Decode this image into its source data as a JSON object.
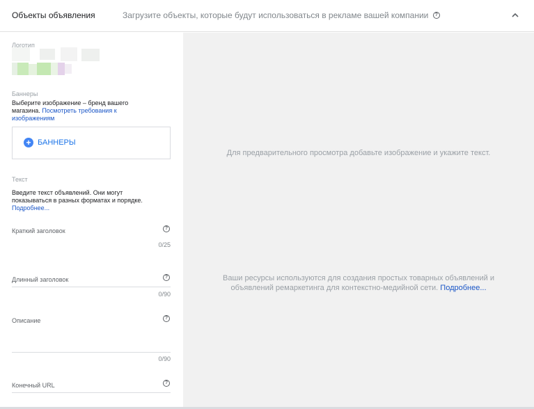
{
  "header": {
    "title": "Объекты объявления",
    "description": "Загрузите объекты, которые будут использоваться в рекламе вашей компании"
  },
  "logo": {
    "label": "Логотип"
  },
  "banners": {
    "label": "Баннеры",
    "description": "Выберите изображение – бренд вашего магазина.",
    "link": "Посмотреть требования к изображениям",
    "button_label": "БАННЕРЫ"
  },
  "text_section": {
    "label": "Текст",
    "description": "Введите текст объявлений. Они могут показываться в разных форматах и порядке.",
    "link": "Подробнее..."
  },
  "fields": {
    "short_headline": {
      "label": "Краткий заголовок",
      "counter": "0/25"
    },
    "long_headline": {
      "label": "Длинный заголовок",
      "counter": "0/90"
    },
    "description": {
      "label": "Описание",
      "counter": "0/90"
    },
    "final_url": {
      "label": "Конечный URL"
    }
  },
  "preview": {
    "placeholder": "Для предварительного просмотра добавьте изображение и укажите текст.",
    "info": "Ваши ресурсы используются для создания простых товарных объявлений и объявлений ремаркетинга для контекстно-медийной сети.",
    "info_link": "Подробнее..."
  },
  "colors": {
    "accent": "#1a73e8",
    "link": "#1a56c7",
    "preview_bg": "#f1f1f1"
  }
}
